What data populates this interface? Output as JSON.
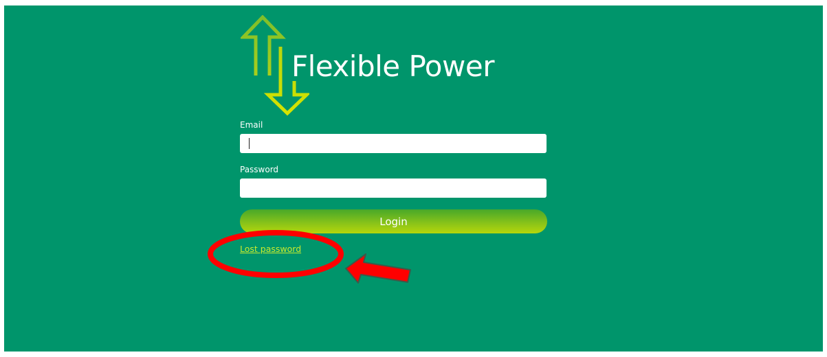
{
  "brand": {
    "title": "Flexible Power",
    "icon": "up-down-arrows-icon"
  },
  "form": {
    "email_label": "Email",
    "email_value": "",
    "password_label": "Password",
    "password_value": "",
    "login_label": "Login",
    "lost_password_label": "Lost password"
  },
  "annotation": {
    "highlight": "red-circle",
    "pointer": "red-arrow-icon"
  },
  "colors": {
    "background": "#00956b",
    "accent_green": "#b6d70b",
    "link": "#c9ea2e",
    "annotation_red": "#ff0000"
  }
}
